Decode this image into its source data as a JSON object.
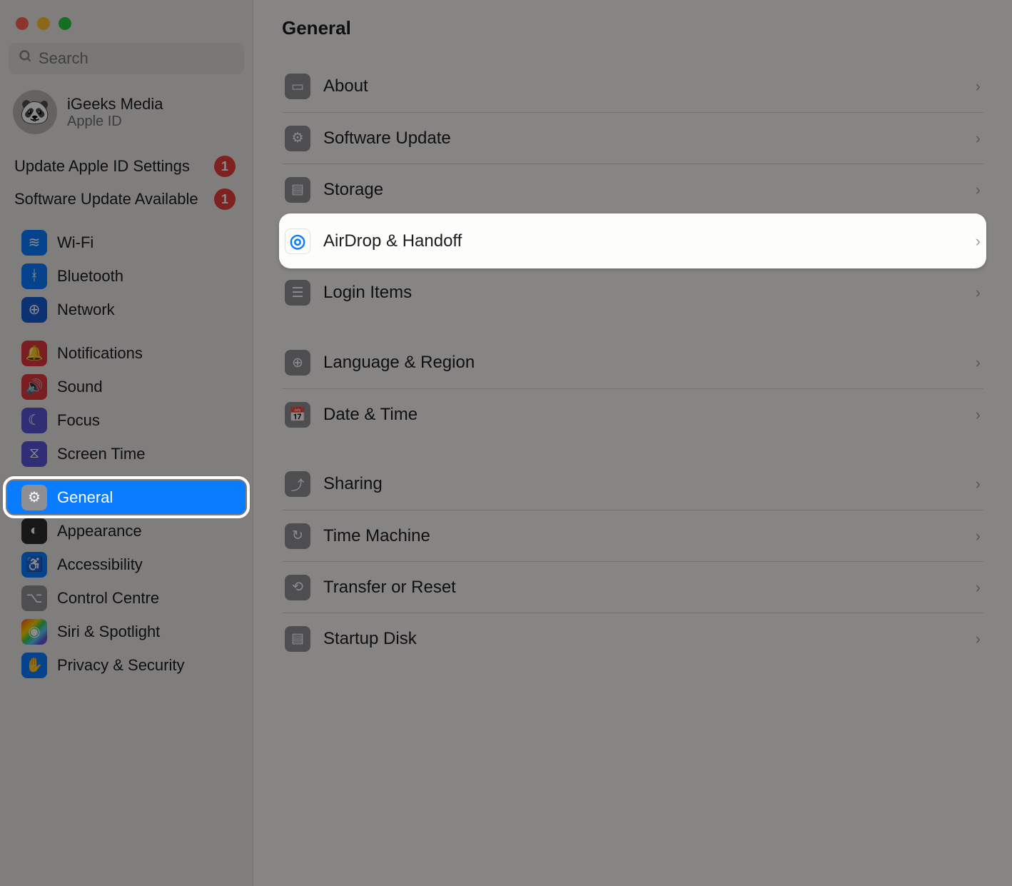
{
  "search": {
    "placeholder": "Search"
  },
  "account": {
    "name": "iGeeks Media",
    "sub": "Apple ID",
    "avatar_glyph": "🐼"
  },
  "alerts": [
    {
      "label": "Update Apple ID Settings",
      "badge": "1"
    },
    {
      "label": "Software Update Available",
      "badge": "1"
    }
  ],
  "sidebar_groups": [
    [
      {
        "name": "wifi",
        "label": "Wi-Fi",
        "glyph": "≋",
        "color": "bg-blue"
      },
      {
        "name": "bluetooth",
        "label": "Bluetooth",
        "glyph": "ᚼ",
        "color": "bg-blue"
      },
      {
        "name": "network",
        "label": "Network",
        "glyph": "⊕",
        "color": "bg-darkblue"
      }
    ],
    [
      {
        "name": "notifications",
        "label": "Notifications",
        "glyph": "🔔",
        "color": "bg-red"
      },
      {
        "name": "sound",
        "label": "Sound",
        "glyph": "🔊",
        "color": "bg-red"
      },
      {
        "name": "focus",
        "label": "Focus",
        "glyph": "☾",
        "color": "bg-indigo"
      },
      {
        "name": "screen-time",
        "label": "Screen Time",
        "glyph": "⧖",
        "color": "bg-indigo"
      }
    ],
    [
      {
        "name": "general",
        "label": "General",
        "glyph": "⚙",
        "color": "bg-gray",
        "selected": true
      },
      {
        "name": "appearance",
        "label": "Appearance",
        "glyph": "◐",
        "color": "bg-black"
      },
      {
        "name": "accessibility",
        "label": "Accessibility",
        "glyph": "♿",
        "color": "bg-blue"
      },
      {
        "name": "control-centre",
        "label": "Control Centre",
        "glyph": "⌥",
        "color": "bg-gray"
      },
      {
        "name": "siri",
        "label": "Siri & Spotlight",
        "glyph": "◉",
        "color": "bg-rainbow"
      },
      {
        "name": "privacy",
        "label": "Privacy & Security",
        "glyph": "✋",
        "color": "bg-blue"
      }
    ]
  ],
  "content": {
    "title": "General",
    "sections": [
      [
        {
          "name": "about",
          "label": "About",
          "glyph": "▭",
          "color": "bg-gray"
        },
        {
          "name": "software-update",
          "label": "Software Update",
          "glyph": "⚙",
          "color": "bg-gray"
        },
        {
          "name": "storage",
          "label": "Storage",
          "glyph": "▤",
          "color": "bg-gray"
        },
        {
          "name": "airdrop",
          "label": "AirDrop & Handoff",
          "glyph": "◎",
          "highlighted": true
        },
        {
          "name": "login-items",
          "label": "Login Items",
          "glyph": "☰",
          "color": "bg-gray"
        }
      ],
      [
        {
          "name": "language-region",
          "label": "Language & Region",
          "glyph": "⊕",
          "color": "bg-blue"
        },
        {
          "name": "date-time",
          "label": "Date & Time",
          "glyph": "📅",
          "color": "bg-blue"
        }
      ],
      [
        {
          "name": "sharing",
          "label": "Sharing",
          "glyph": "⤴",
          "color": "bg-gray"
        },
        {
          "name": "time-machine",
          "label": "Time Machine",
          "glyph": "↻",
          "color": "bg-gray"
        },
        {
          "name": "transfer-reset",
          "label": "Transfer or Reset",
          "glyph": "⟲",
          "color": "bg-gray"
        },
        {
          "name": "startup-disk",
          "label": "Startup Disk",
          "glyph": "▤",
          "color": "bg-gray"
        }
      ]
    ]
  }
}
